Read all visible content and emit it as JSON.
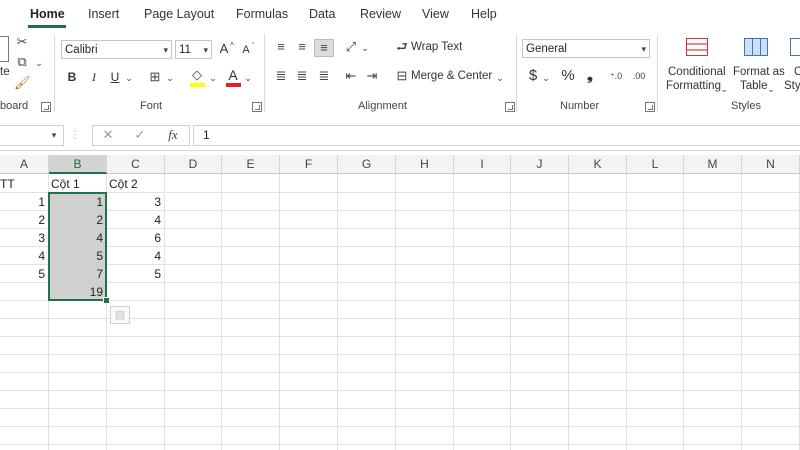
{
  "tabs": [
    {
      "label": "Home",
      "active": true
    },
    {
      "label": "Insert"
    },
    {
      "label": "Page Layout"
    },
    {
      "label": "Formulas"
    },
    {
      "label": "Data"
    },
    {
      "label": "Review"
    },
    {
      "label": "View"
    },
    {
      "label": "Help"
    }
  ],
  "ribbon": {
    "clipboard": {
      "paste_label": "te",
      "group_label": "board"
    },
    "font": {
      "name": "Calibri",
      "size": "11",
      "group_label": "Font",
      "bold": "B",
      "italic": "I",
      "underline": "U",
      "grow": "A",
      "shrink": "A"
    },
    "alignment": {
      "wrap_text": "Wrap Text",
      "merge_center": "Merge & Center",
      "group_label": "Alignment"
    },
    "number": {
      "format": "General",
      "currency": "$",
      "percent": "%",
      "comma": "❟",
      "group_label": "Number"
    },
    "styles": {
      "conditional_formatting_line1": "Conditional",
      "conditional_formatting_line2": "Formatting",
      "format_as_table_line1": "Format as",
      "format_as_table_line2": "Table",
      "cell_styles_line1": "C",
      "cell_styles_line2": "Sty",
      "group_label": "Styles"
    },
    "accent_color": "#217346"
  },
  "formula_bar": {
    "fx": "fx",
    "value": "1"
  },
  "sheet": {
    "columns": [
      "A",
      "B",
      "C",
      "D",
      "E",
      "F",
      "G",
      "H",
      "I",
      "J",
      "K",
      "L",
      "M",
      "N"
    ],
    "selected_column": "B",
    "rows": [
      {
        "a": "TT",
        "b": "Cột 1",
        "c": "Cột 2"
      },
      {
        "a": "1",
        "b": "1",
        "c": "3"
      },
      {
        "a": "2",
        "b": "2",
        "c": "4"
      },
      {
        "a": "3",
        "b": "4",
        "c": "6"
      },
      {
        "a": "4",
        "b": "5",
        "c": "4"
      },
      {
        "a": "5",
        "b": "7",
        "c": "5"
      },
      {
        "a": "",
        "b": "19",
        "c": ""
      }
    ]
  }
}
